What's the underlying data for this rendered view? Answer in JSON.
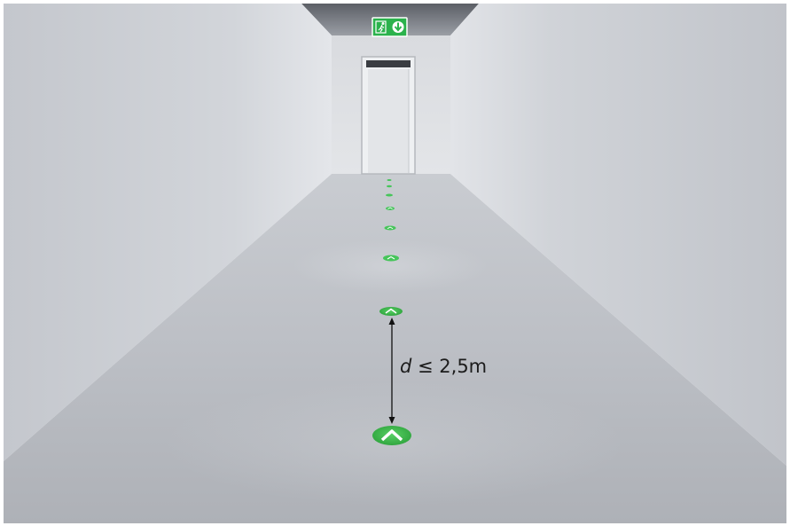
{
  "scene": {
    "description_type": "rendered corridor illustration",
    "exit_sign": {
      "icon": "running-man-exit-icon",
      "arrow_icon": "arrow-down-icon",
      "color": "#2bb24c"
    },
    "floor_markers": {
      "count": 8,
      "icon": "chevron-up-icon",
      "color": "#3fbf4f"
    }
  },
  "annotation": {
    "variable": "d",
    "relation": " ≤ 2,5m"
  }
}
